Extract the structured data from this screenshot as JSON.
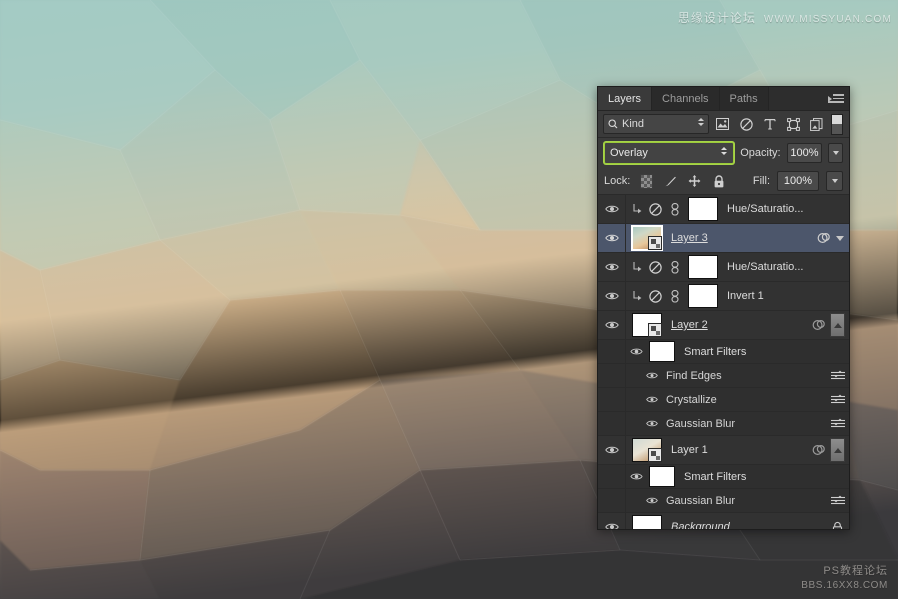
{
  "watermarks": {
    "top_cn": "思缘设计论坛",
    "top_en": "WWW.MISSYUAN.COM",
    "bottom_cn": "PS教程论坛",
    "bottom_en": "BBS.16XX8.COM"
  },
  "background": {
    "style": "low-poly crystallize gradient",
    "top_color": "#9cc6bf",
    "mid_color": "#e0c49c",
    "bottom_color": "#3c3a3d"
  },
  "panel": {
    "tabs": [
      {
        "label": "Layers",
        "active": true
      },
      {
        "label": "Channels",
        "active": false
      },
      {
        "label": "Paths",
        "active": false
      }
    ],
    "menu_icon": "panel-menu-icon",
    "filter": {
      "search_icon": "search-icon",
      "kind_label": "Kind",
      "icons": [
        "pixel-layer-filter-icon",
        "adjustment-layer-filter-icon",
        "type-layer-filter-icon",
        "shape-layer-filter-icon",
        "smart-object-filter-icon"
      ],
      "toggle_icon": "filter-enable-toggle"
    },
    "blend": {
      "mode": "Overlay",
      "opacity_label": "Opacity:",
      "opacity_value": "100%",
      "fill_label": "Fill:",
      "fill_value": "100%"
    },
    "lock": {
      "label": "Lock:",
      "icons": [
        "lock-transparent-pixels-icon",
        "lock-image-pixels-icon",
        "lock-position-icon",
        "lock-all-icon"
      ]
    },
    "layers": [
      {
        "name": "Hue/Saturatio...",
        "type": "adjustment",
        "visible": true,
        "clipped": true,
        "linked": true,
        "selected": false,
        "thumb": "white",
        "indent": 0
      },
      {
        "name": "Layer 3",
        "type": "smart-object",
        "visible": true,
        "clipped": false,
        "linked": false,
        "selected": true,
        "thumb": "gradient",
        "has_fx": true,
        "has_dropdown": true,
        "indent": 0
      },
      {
        "name": "Hue/Saturatio...",
        "type": "adjustment",
        "visible": true,
        "clipped": true,
        "linked": true,
        "selected": false,
        "thumb": "white",
        "indent": 0
      },
      {
        "name": "Invert 1",
        "type": "adjustment",
        "visible": true,
        "clipped": true,
        "linked": true,
        "selected": false,
        "thumb": "white",
        "indent": 0
      },
      {
        "name": "Layer 2",
        "type": "smart-object",
        "visible": true,
        "selected": false,
        "thumb": "white-so",
        "has_fx": true,
        "has_collapse": true,
        "indent": 0
      },
      {
        "name": "Smart Filters",
        "type": "smart-filters-header",
        "visible": true,
        "thumb": "white",
        "indent": 1
      },
      {
        "name": "Find Edges",
        "type": "smart-filter",
        "visible": true,
        "indent": 2
      },
      {
        "name": "Crystallize",
        "type": "smart-filter",
        "visible": true,
        "indent": 2
      },
      {
        "name": "Gaussian Blur",
        "type": "smart-filter",
        "visible": true,
        "indent": 2
      },
      {
        "name": "Layer 1",
        "type": "smart-object",
        "visible": true,
        "selected": false,
        "thumb": "gradient",
        "has_fx": true,
        "has_collapse": true,
        "indent": 0
      },
      {
        "name": "Smart Filters",
        "type": "smart-filters-header",
        "visible": true,
        "thumb": "white",
        "indent": 1
      },
      {
        "name": "Gaussian Blur",
        "type": "smart-filter",
        "visible": true,
        "indent": 2
      },
      {
        "name": "Background",
        "type": "background",
        "visible": true,
        "locked": true,
        "italic": true,
        "thumb": "white",
        "indent": 0
      }
    ]
  }
}
